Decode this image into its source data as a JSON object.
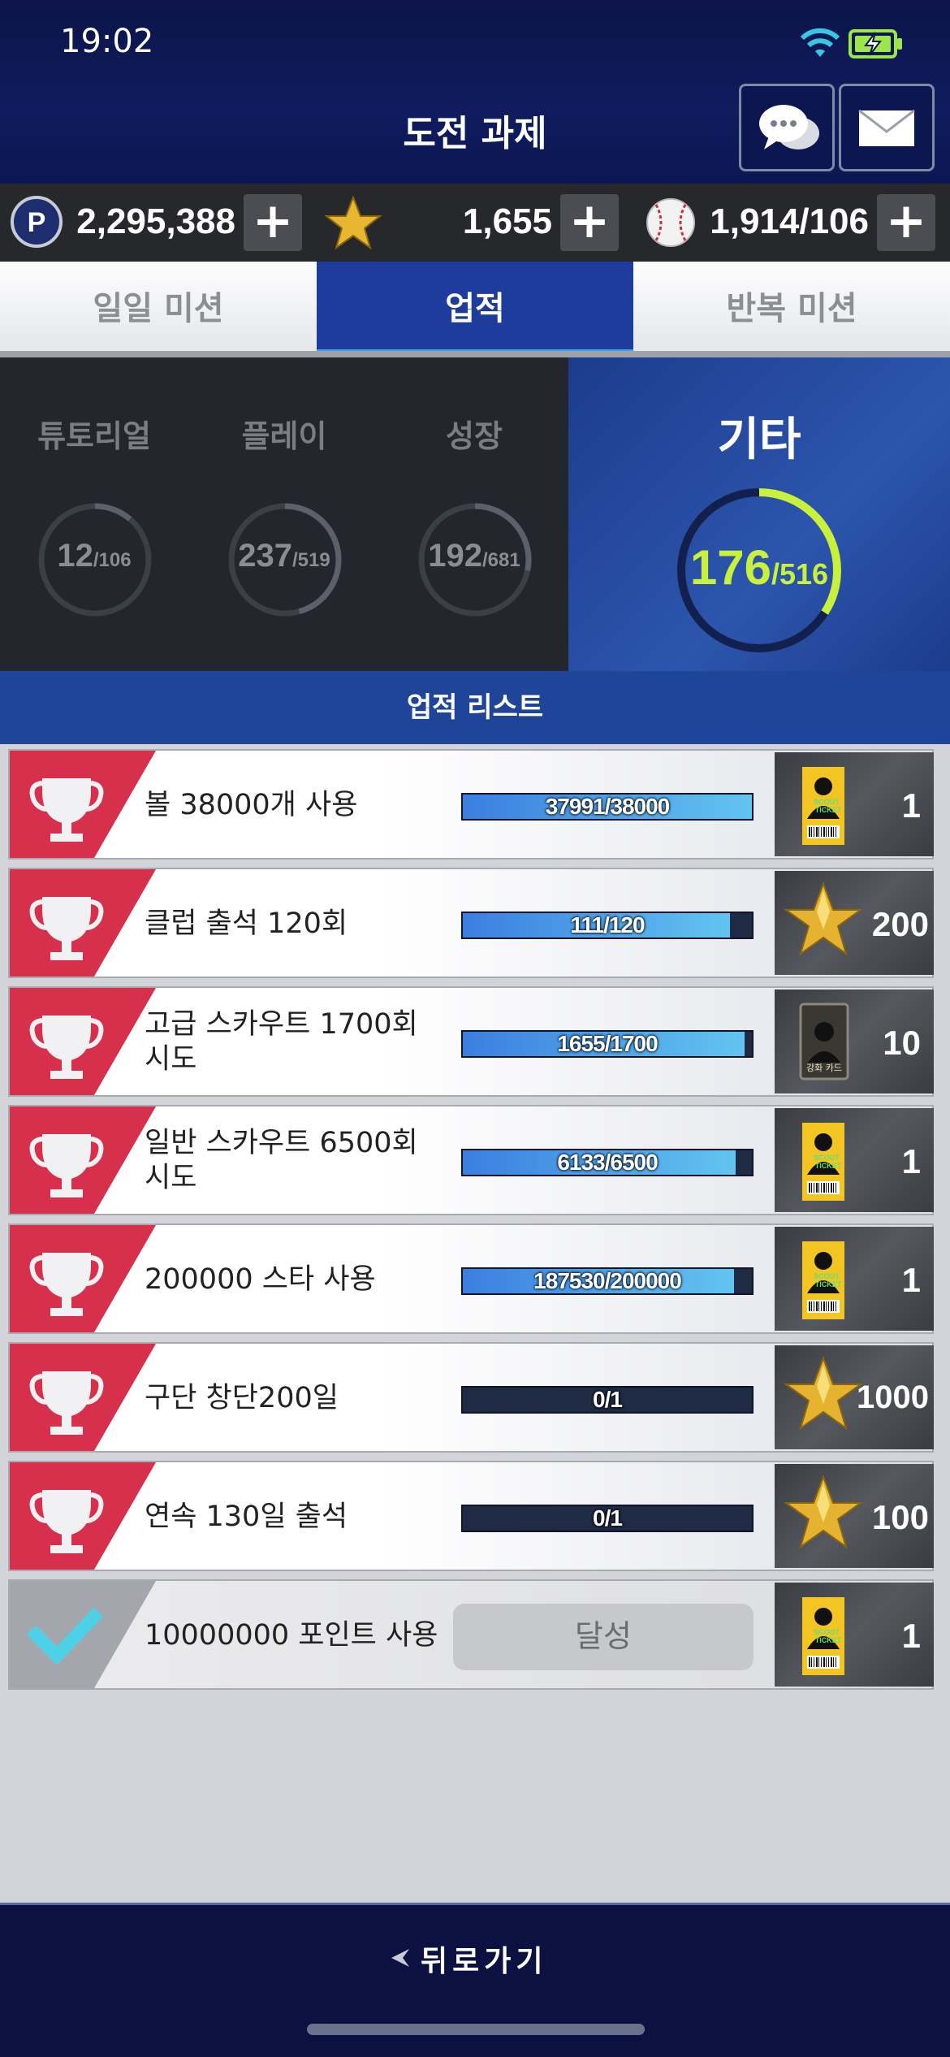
{
  "status": {
    "time": "19:02"
  },
  "header": {
    "title": "도전 과제"
  },
  "currency": [
    {
      "icon": "p-point-icon",
      "value": "2,295,388"
    },
    {
      "icon": "star-icon",
      "value": "1,655"
    },
    {
      "icon": "baseball-icon",
      "value": "1,914/106"
    }
  ],
  "tabs": [
    {
      "label": "일일 미션",
      "active": false
    },
    {
      "label": "업적",
      "active": true
    },
    {
      "label": "반복 미션",
      "active": false
    }
  ],
  "categories": [
    {
      "label": "튜토리얼",
      "current": "12",
      "total": "/106",
      "progress": 0.113
    },
    {
      "label": "플레이",
      "current": "237",
      "total": "/519",
      "progress": 0.457
    },
    {
      "label": "성장",
      "current": "192",
      "total": "/681",
      "progress": 0.282
    },
    {
      "label": "기타",
      "current": "176",
      "total": "/516",
      "progress": 0.341
    }
  ],
  "list_title": "업적 리스트",
  "achievements": [
    {
      "name": "볼 38000개 사용",
      "progress_text": "37991/38000",
      "progress": 0.9998,
      "reward": "scout-ticket",
      "reward_count": "1",
      "done": false
    },
    {
      "name": "클럽 출석 120회",
      "progress_text": "111/120",
      "progress": 0.925,
      "reward": "star",
      "reward_count": "200",
      "done": false
    },
    {
      "name": "고급 스카우트 1700회 시도",
      "progress_text": "1655/1700",
      "progress": 0.9735,
      "reward": "card",
      "reward_count": "10",
      "done": false
    },
    {
      "name": "일반 스카우트 6500회 시도",
      "progress_text": "6133/6500",
      "progress": 0.9435,
      "reward": "scout-ticket",
      "reward_count": "1",
      "done": false
    },
    {
      "name": "200000 스타 사용",
      "progress_text": "187530/200000",
      "progress": 0.9377,
      "reward": "scout-ticket",
      "reward_count": "1",
      "done": false
    },
    {
      "name": "구단 창단200일",
      "progress_text": "0/1",
      "progress": 0,
      "reward": "star",
      "reward_count": "1000",
      "done": false
    },
    {
      "name": "연속 130일 출석",
      "progress_text": "0/1",
      "progress": 0,
      "reward": "star",
      "reward_count": "100",
      "done": false
    },
    {
      "name": "10000000 포인트 사용",
      "achieved_label": "달성",
      "reward": "scout-ticket",
      "reward_count": "1",
      "done": true
    }
  ],
  "reward_texts": {
    "ticket_line1": "SCOUT",
    "ticket_line2": "TICKET",
    "card_label": "강화 카드"
  },
  "back_label": "뒤로가기",
  "colors": {
    "accent_green": "#c8f03c",
    "tab_active": "#1e3c9c",
    "ribbon_red": "#d7304c"
  }
}
